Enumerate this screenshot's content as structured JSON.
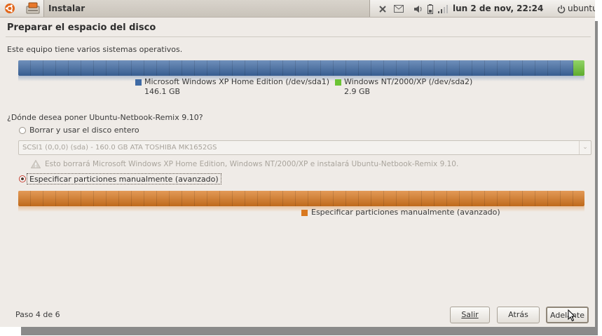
{
  "panel": {
    "window_title": "Instalar",
    "clock": "lun  2 de nov, 22:24",
    "user": "ubuntu",
    "icons": [
      "ubuntu-logo-icon",
      "installer-app-icon",
      "bluetooth-x-icon",
      "mail-icon",
      "volume-icon",
      "battery-icon",
      "network-signal-icon",
      "power-icon"
    ]
  },
  "page": {
    "heading": "Preparar el espacio del disco",
    "intro": "Este equipo tiene varios sistemas operativos."
  },
  "disk_bar": {
    "partitions": [
      {
        "name": "Microsoft Windows XP Home Edition (/dev/sda1)",
        "size": "146.1 GB",
        "color": "#3f6aa4",
        "fraction": 0.98
      },
      {
        "name": "Windows NT/2000/XP (/dev/sda2)",
        "size": "2.9 GB",
        "color": "#6cc434",
        "fraction": 0.02
      }
    ]
  },
  "question": "¿Dónde desea poner Ubuntu-Netbook-Remix 9.10?",
  "options": {
    "erase": {
      "label": "Borrar y usar el disco entero",
      "selected": false,
      "disk_select": "SCSI1 (0,0,0) (sda) - 160.0 GB ATA TOSHIBA MK1652GS",
      "warning": "Esto borrará Microsoft Windows XP Home Edition, Windows NT/2000/XP e instalará Ubuntu-Netbook-Remix 9.10."
    },
    "manual": {
      "label": "Especificar particiones manualmente (avanzado)",
      "selected": true
    }
  },
  "manual_bar": {
    "color": "#d9781f",
    "legend": "Especificar particiones manualmente (avanzado)"
  },
  "footer": {
    "step": "Paso 4 de 6",
    "buttons": {
      "quit": "Salir",
      "back": "Atrás",
      "forward": "Adelante"
    }
  }
}
